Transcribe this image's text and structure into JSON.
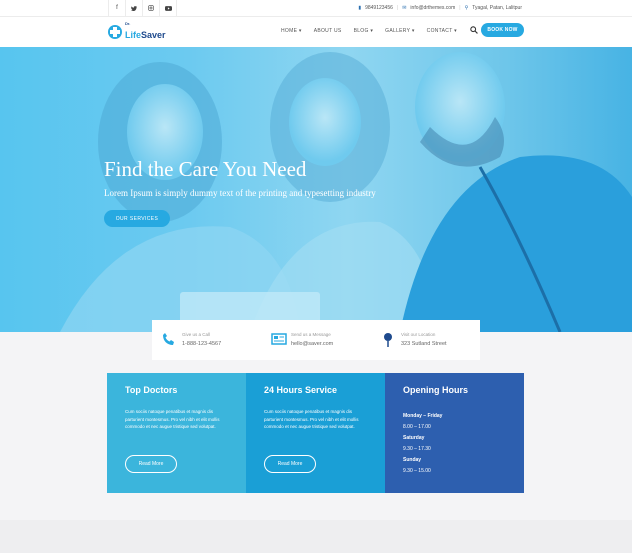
{
  "topbar": {
    "phone": "9849123456",
    "email": "info@drthemes.com",
    "address": "Tyagal, Patan, Lalitpur",
    "social_icons": [
      "facebook-icon",
      "twitter-icon",
      "instagram-icon",
      "youtube-icon"
    ]
  },
  "logo": {
    "prefix": "Dr.",
    "name_part1": "Life",
    "name_part2": "Saver"
  },
  "nav": {
    "items": [
      "HOME ▾",
      "ABOUT US",
      "BLOG ▾",
      "GALLERY ▾",
      "CONTACT ▾"
    ],
    "book_label": "BOOK NOW"
  },
  "hero": {
    "title": "Find the Care You Need",
    "subtitle": "Lorem Ipsum is simply dummy text of the printing and typesetting industry",
    "button_label": "OUR SERVICES"
  },
  "info": [
    {
      "label": "Give us a Call",
      "value": "1-888-123-4567",
      "icon": "phone-icon"
    },
    {
      "label": "Send us a Message",
      "value": "hello@saver.com",
      "icon": "newspaper-icon"
    },
    {
      "label": "Visit our Location",
      "value": "323 Sutland Street",
      "icon": "pin-icon"
    }
  ],
  "cards": [
    {
      "title": "Top Doctors",
      "text": "Cum sociis natoque penatibus et magnis dis parturient montesmus. Pro vel nibh et elit mollis commodo et nec augue tristique sed volutpat.",
      "button": "Read More",
      "color": "#3bb5dc"
    },
    {
      "title": "24 Hours Service",
      "text": "Cum sociis natoque penatibus et magnis dis parturient montesmus. Pro vel nibh et elit mollis commodo et nec augue tristique sed volutpat.",
      "button": "Read More",
      "color": "#1a9fd6"
    },
    {
      "title": "Opening Hours",
      "hours": [
        {
          "day": "Monday – Friday",
          "time": "8.00 – 17.00"
        },
        {
          "day": "Saturday",
          "time": "9.30 – 17.30"
        },
        {
          "day": "Sunday",
          "time": "9.30 – 15.00"
        }
      ],
      "color": "#2d5faf"
    }
  ],
  "colors": {
    "accent": "#27a9e1",
    "brand_dark": "#1e4a8d"
  }
}
